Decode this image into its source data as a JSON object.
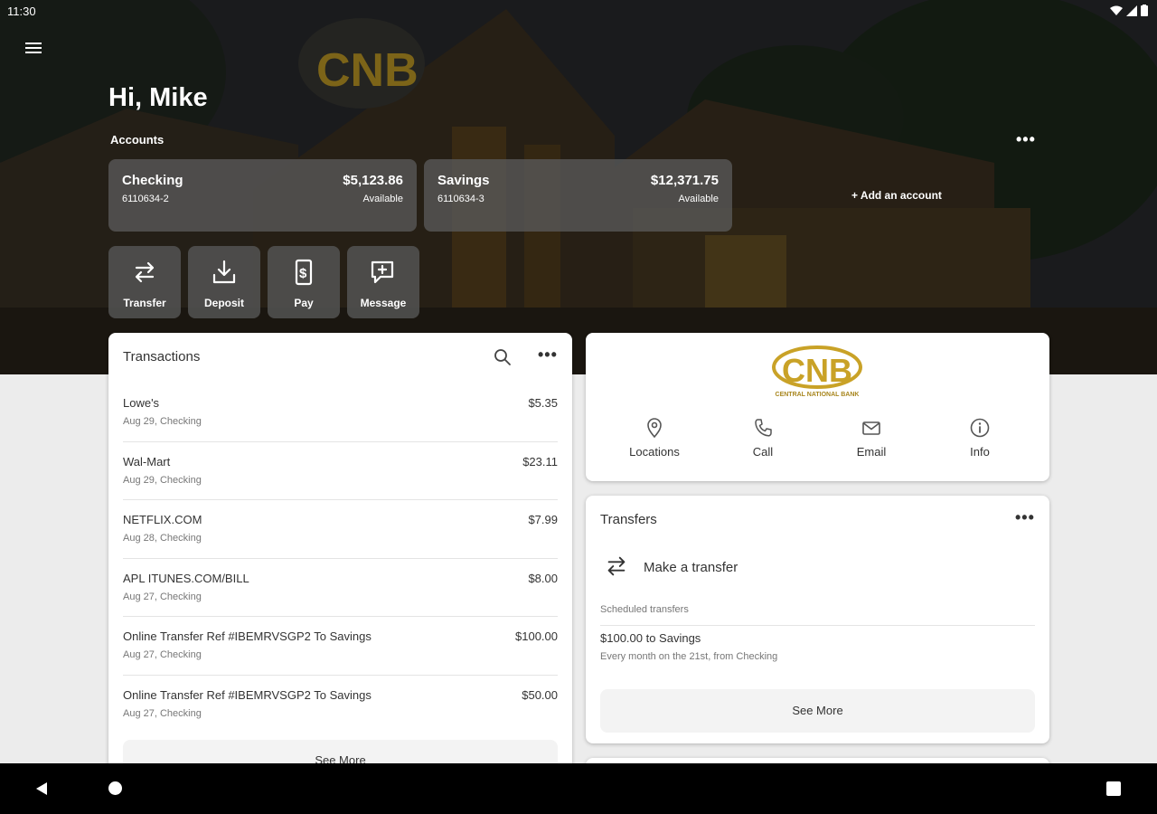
{
  "status_bar": {
    "time": "11:30"
  },
  "greeting": "Hi, Mike",
  "accounts": {
    "label": "Accounts",
    "more": "•••",
    "items": [
      {
        "name": "Checking",
        "number": "6110634-2",
        "balance": "$5,123.86",
        "balance_label": "Available"
      },
      {
        "name": "Savings",
        "number": "6110634-3",
        "balance": "$12,371.75",
        "balance_label": "Available"
      }
    ],
    "add_account": "+ Add an account"
  },
  "quick_actions": [
    {
      "label": "Transfer",
      "icon": "transfer-icon"
    },
    {
      "label": "Deposit",
      "icon": "deposit-icon"
    },
    {
      "label": "Pay",
      "icon": "pay-icon"
    },
    {
      "label": "Message",
      "icon": "message-icon"
    }
  ],
  "transactions": {
    "title": "Transactions",
    "more": "•••",
    "items": [
      {
        "description": "Lowe's",
        "meta": "Aug 29, Checking",
        "amount": "$5.35"
      },
      {
        "description": "Wal-Mart",
        "meta": "Aug 29, Checking",
        "amount": "$23.11"
      },
      {
        "description": "NETFLIX.COM",
        "meta": "Aug 28, Checking",
        "amount": "$7.99"
      },
      {
        "description": "APL ITUNES.COM/BILL",
        "meta": "Aug 27, Checking",
        "amount": "$8.00"
      },
      {
        "description": "Online Transfer Ref #IBEMRVSGP2 To Savings",
        "meta": "Aug 27, Checking",
        "amount": "$100.00"
      },
      {
        "description": "Online Transfer Ref #IBEMRVSGP2 To Savings",
        "meta": "Aug 27, Checking",
        "amount": "$50.00"
      }
    ],
    "see_more": "See More"
  },
  "bank": {
    "logo_text": "CNB",
    "logo_subtext": "CENTRAL NATIONAL BANK",
    "actions": [
      {
        "label": "Locations",
        "icon": "location-pin-icon"
      },
      {
        "label": "Call",
        "icon": "phone-icon"
      },
      {
        "label": "Email",
        "icon": "email-icon"
      },
      {
        "label": "Info",
        "icon": "info-icon"
      }
    ]
  },
  "transfers": {
    "title": "Transfers",
    "more": "•••",
    "make_transfer": "Make a transfer",
    "scheduled_label": "Scheduled transfers",
    "scheduled": [
      {
        "title": "$100.00 to Savings",
        "subtitle": "Every month on the 21st, from Checking"
      }
    ],
    "see_more": "See More"
  },
  "colors": {
    "accent_gold": "#c9a227",
    "card_bg": "#ffffff",
    "page_bg": "#ececec"
  }
}
